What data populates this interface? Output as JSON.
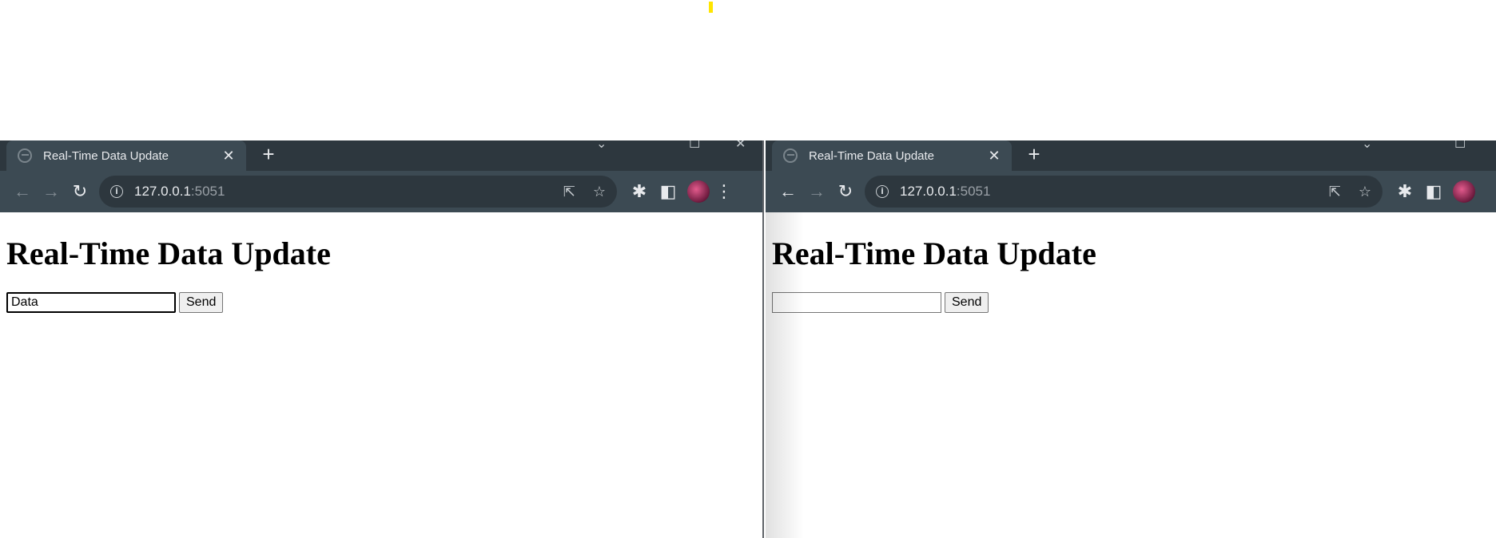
{
  "left_window": {
    "tab_title": "Real-Time Data Update",
    "tab_close": "✕",
    "new_tab": "+",
    "url_host": "127.0.0.1",
    "url_port": ":5051",
    "page_heading": "Real-Time Data Update",
    "input_value": "Data",
    "send_label": "Send"
  },
  "right_window": {
    "tab_title": "Real-Time Data Update",
    "tab_close": "✕",
    "new_tab": "+",
    "url_host": "127.0.0.1",
    "url_port": ":5051",
    "page_heading": "Real-Time Data Update",
    "input_value": "",
    "send_label": "Send"
  },
  "icons": {
    "back": "←",
    "forward": "→",
    "reload": "↻",
    "info": "i",
    "share": "⇱",
    "star": "☆",
    "extensions": "✱",
    "sidepanel": "◧",
    "menu": "⋮",
    "minimize": "—",
    "maximize": "☐",
    "close": "✕",
    "chevron": "⌄"
  },
  "colors": {
    "tabstrip": "#2d373e",
    "toolbar": "#3c4a53",
    "highlight_mark": "#ffe500"
  }
}
